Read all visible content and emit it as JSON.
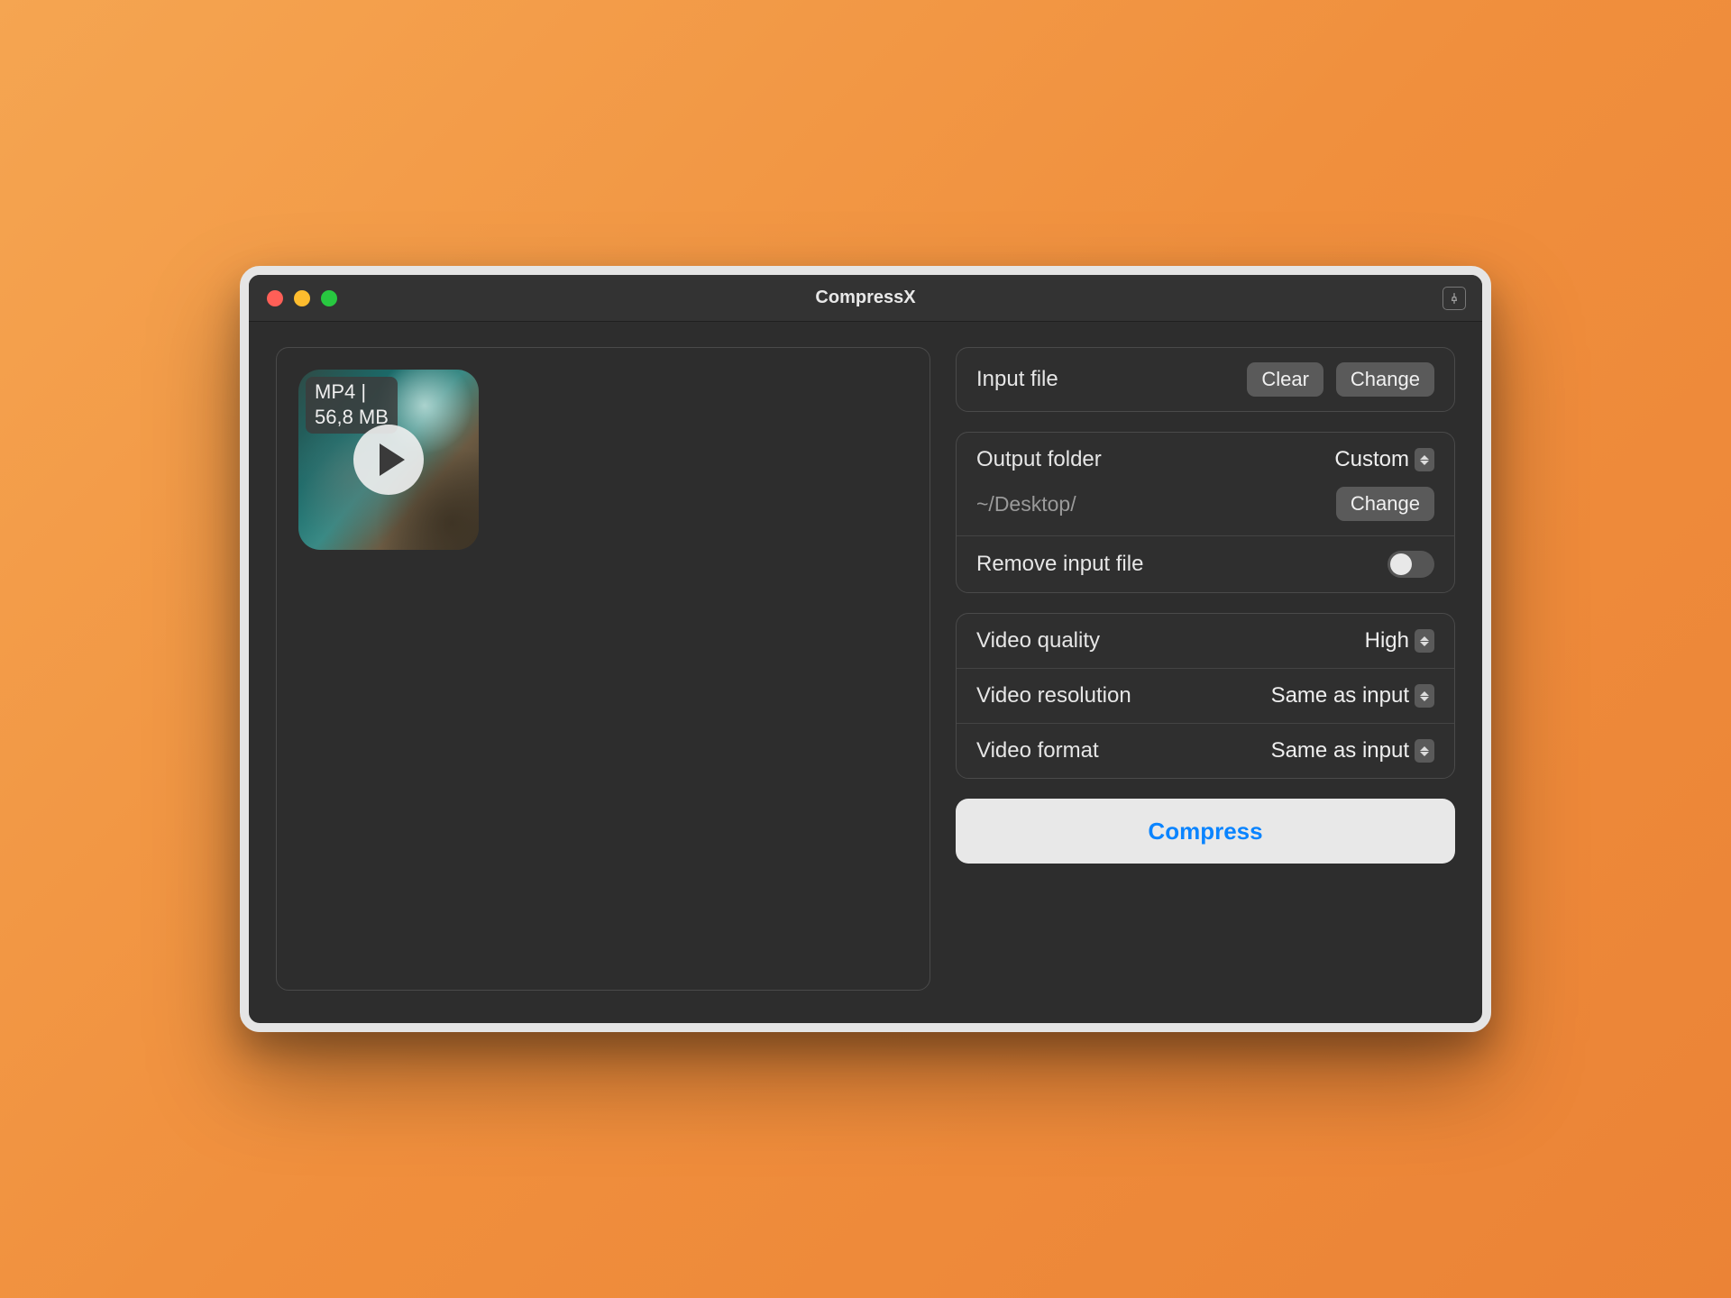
{
  "window": {
    "title": "CompressX"
  },
  "file": {
    "badge_line1": "MP4 |",
    "badge_line2": "56,8 MB"
  },
  "panels": {
    "input": {
      "label": "Input file",
      "clear": "Clear",
      "change": "Change"
    },
    "output": {
      "label": "Output folder",
      "mode": "Custom",
      "path": "~/Desktop/",
      "change": "Change",
      "remove_label": "Remove input file",
      "remove_on": false
    },
    "video": {
      "quality_label": "Video quality",
      "quality_value": "High",
      "resolution_label": "Video resolution",
      "resolution_value": "Same as input",
      "format_label": "Video format",
      "format_value": "Same as input"
    },
    "action": {
      "compress": "Compress"
    }
  }
}
